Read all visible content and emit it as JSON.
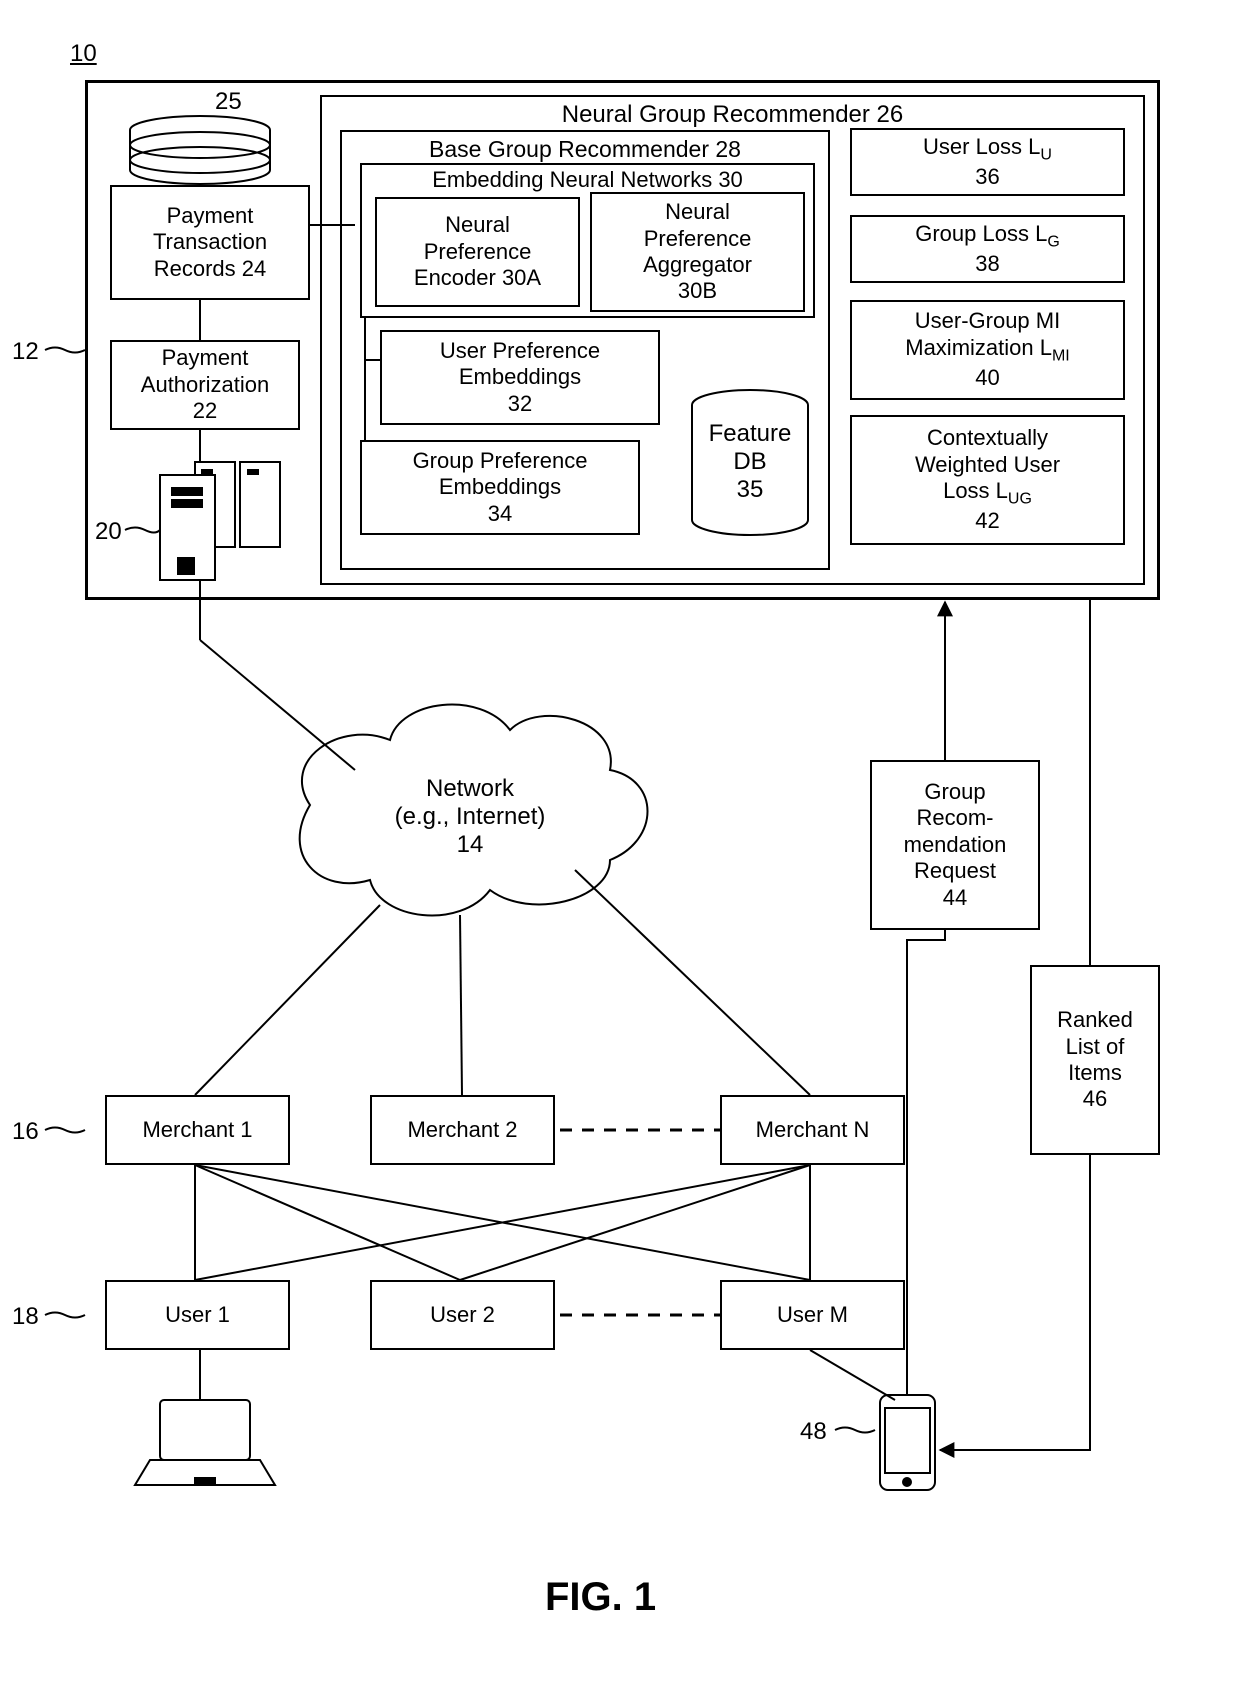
{
  "figure_ref": "10",
  "outer_ref": "12",
  "server_ref": "20",
  "db_top_ref": "25",
  "merchant_ref_left": "16",
  "user_ref_left": "18",
  "phone_ref": "48",
  "caption": "FIG. 1",
  "payment_records": {
    "l1": "Payment",
    "l2": "Transaction",
    "l3": "Records 24"
  },
  "payment_auth": {
    "l1": "Payment",
    "l2": "Authorization",
    "l3": "22"
  },
  "ngr_title": "Neural Group Recommender 26",
  "bgr_title": "Base Group Recommender 28",
  "enn_title": "Embedding Neural Networks 30",
  "npe": {
    "l1": "Neural",
    "l2": "Preference",
    "l3": "Encoder 30A"
  },
  "npa": {
    "l1": "Neural",
    "l2": "Preference",
    "l3": "Aggregator",
    "l4": "30B"
  },
  "upe": {
    "l1": "User Preference",
    "l2": "Embeddings",
    "l3": "32"
  },
  "gpe": {
    "l1": "Group Preference",
    "l2": "Embeddings",
    "l3": "34"
  },
  "featuredb": {
    "l1": "Feature",
    "l2": "DB",
    "l3": "35"
  },
  "userloss": {
    "l1": "User Loss  L",
    "l2": "36",
    "sub": "U"
  },
  "grouploss": {
    "l1": "Group Loss  L",
    "l2": "38",
    "sub": "G"
  },
  "ugmi": {
    "l1": "User-Group MI",
    "l2": "Maximization  L",
    "l3": "40",
    "sub": "MI"
  },
  "cwul": {
    "l1": "Contextually",
    "l2": "Weighted User",
    "l3": "Loss L",
    "l4": "42",
    "sub": "UG"
  },
  "network": {
    "l1": "Network",
    "l2": "(e.g., Internet)",
    "l3": "14"
  },
  "grr": {
    "l1": "Group",
    "l2": "Recom-",
    "l3": "mendation",
    "l4": "Request",
    "l5": "44"
  },
  "rli": {
    "l1": "Ranked",
    "l2": "List of",
    "l3": "Items",
    "l4": "46"
  },
  "merchants": [
    "Merchant 1",
    "Merchant 2",
    "Merchant N"
  ],
  "users": [
    "User 1",
    "User 2",
    "User M"
  ]
}
